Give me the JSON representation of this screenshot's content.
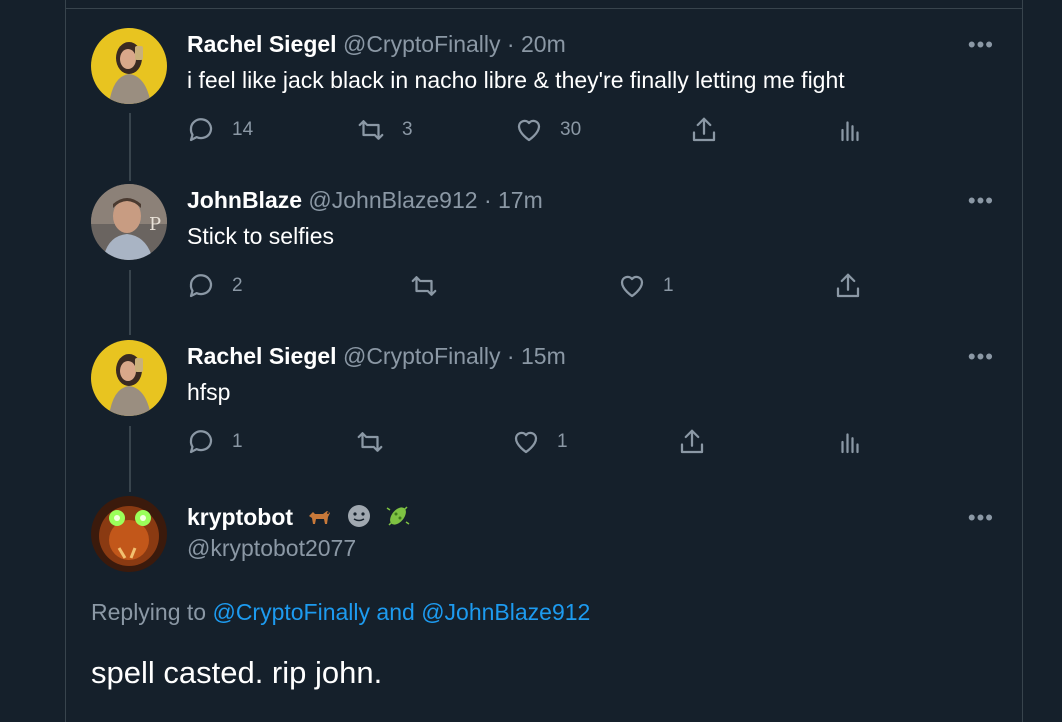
{
  "tweets": [
    {
      "name": "Rachel Siegel",
      "handle": "@CryptoFinally",
      "dot": "·",
      "time": "20m",
      "text": "i feel like jack black in nacho libre & they're finally letting me fight",
      "more": "•••",
      "replies": "14",
      "retweets": "3",
      "likes": "30"
    },
    {
      "name": "JohnBlaze",
      "handle": "@JohnBlaze912",
      "dot": "·",
      "time": "17m",
      "text": "Stick to selfies",
      "more": "•••",
      "replies": "2",
      "retweets": "",
      "likes": "1"
    },
    {
      "name": "Rachel Siegel",
      "handle": "@CryptoFinally",
      "dot": "·",
      "time": "15m",
      "text": "hfsp",
      "more": "•••",
      "replies": "1",
      "retweets": "",
      "likes": "1"
    }
  ],
  "main_tweet": {
    "name": "kryptobot",
    "name_emojis": [
      "dog-emoji",
      "grey-face-emoji",
      "microbe-emoji"
    ],
    "handle": "@kryptobot2077",
    "more": "•••",
    "replying_prefix": "Replying to",
    "mention1": "@CryptoFinally",
    "and": "and",
    "mention2": "@JohnBlaze912",
    "text": "spell casted. rip john."
  },
  "colors": {
    "background": "#15202b",
    "border": "#38444d",
    "secondary_text": "#8b98a5",
    "link": "#1d9bf0"
  }
}
